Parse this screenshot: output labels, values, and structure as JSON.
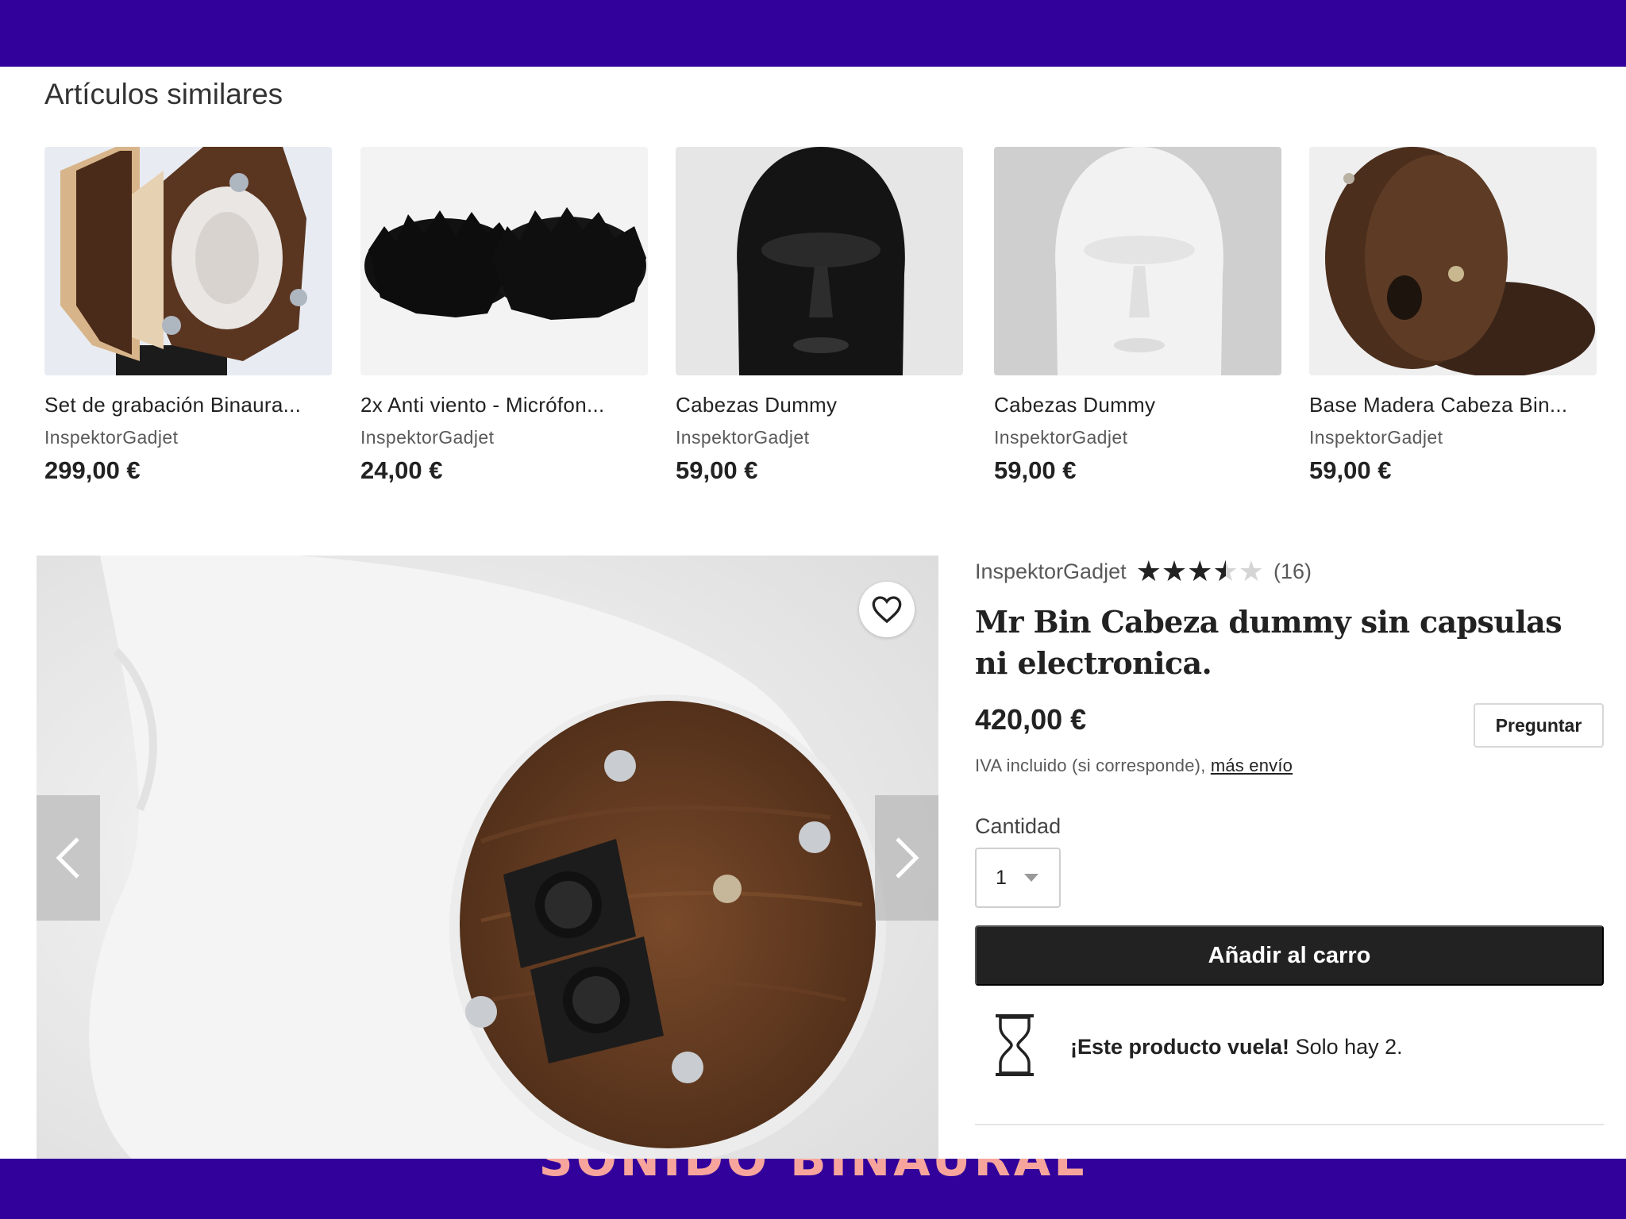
{
  "similar": {
    "title": "Artículos similares",
    "items": [
      {
        "title": "Set de grabación Binaura...",
        "shop": "InspektorGadjet",
        "price": "299,00 €"
      },
      {
        "title": "2x Anti viento - Micrófon...",
        "shop": "InspektorGadjet",
        "price": "24,00 €"
      },
      {
        "title": "Cabezas Dummy",
        "shop": "InspektorGadjet",
        "price": "59,00 €"
      },
      {
        "title": "Cabezas Dummy",
        "shop": "InspektorGadjet",
        "price": "59,00 €"
      },
      {
        "title": "Base Madera Cabeza Bin...",
        "shop": "InspektorGadjet",
        "price": "59,00 €"
      }
    ]
  },
  "product": {
    "shop": "InspektorGadjet",
    "rating": 3.5,
    "review_count": "(16)",
    "title": "Mr Bin Cabeza dummy sin capsulas ni electronica.",
    "price": "420,00 €",
    "ask_label": "Preguntar",
    "vat_text": "IVA incluido (si corresponde),",
    "shipping_link": "más envío",
    "quantity_label": "Cantidad",
    "quantity_value": "1",
    "add_to_cart_label": "Añadir al carro",
    "notice_bold": "¡Este producto vuela!",
    "notice_text": "Solo hay 2."
  },
  "banner_caption": "SONIDO BINAURAL",
  "colors": {
    "band": "#32009a",
    "caption": "#f7a59c",
    "cart_button": "#222222"
  },
  "icons": {
    "favorite": "heart-icon",
    "prev": "chevron-left-icon",
    "next": "chevron-right-icon",
    "stock": "hourglass-icon",
    "select": "caret-down-icon"
  }
}
